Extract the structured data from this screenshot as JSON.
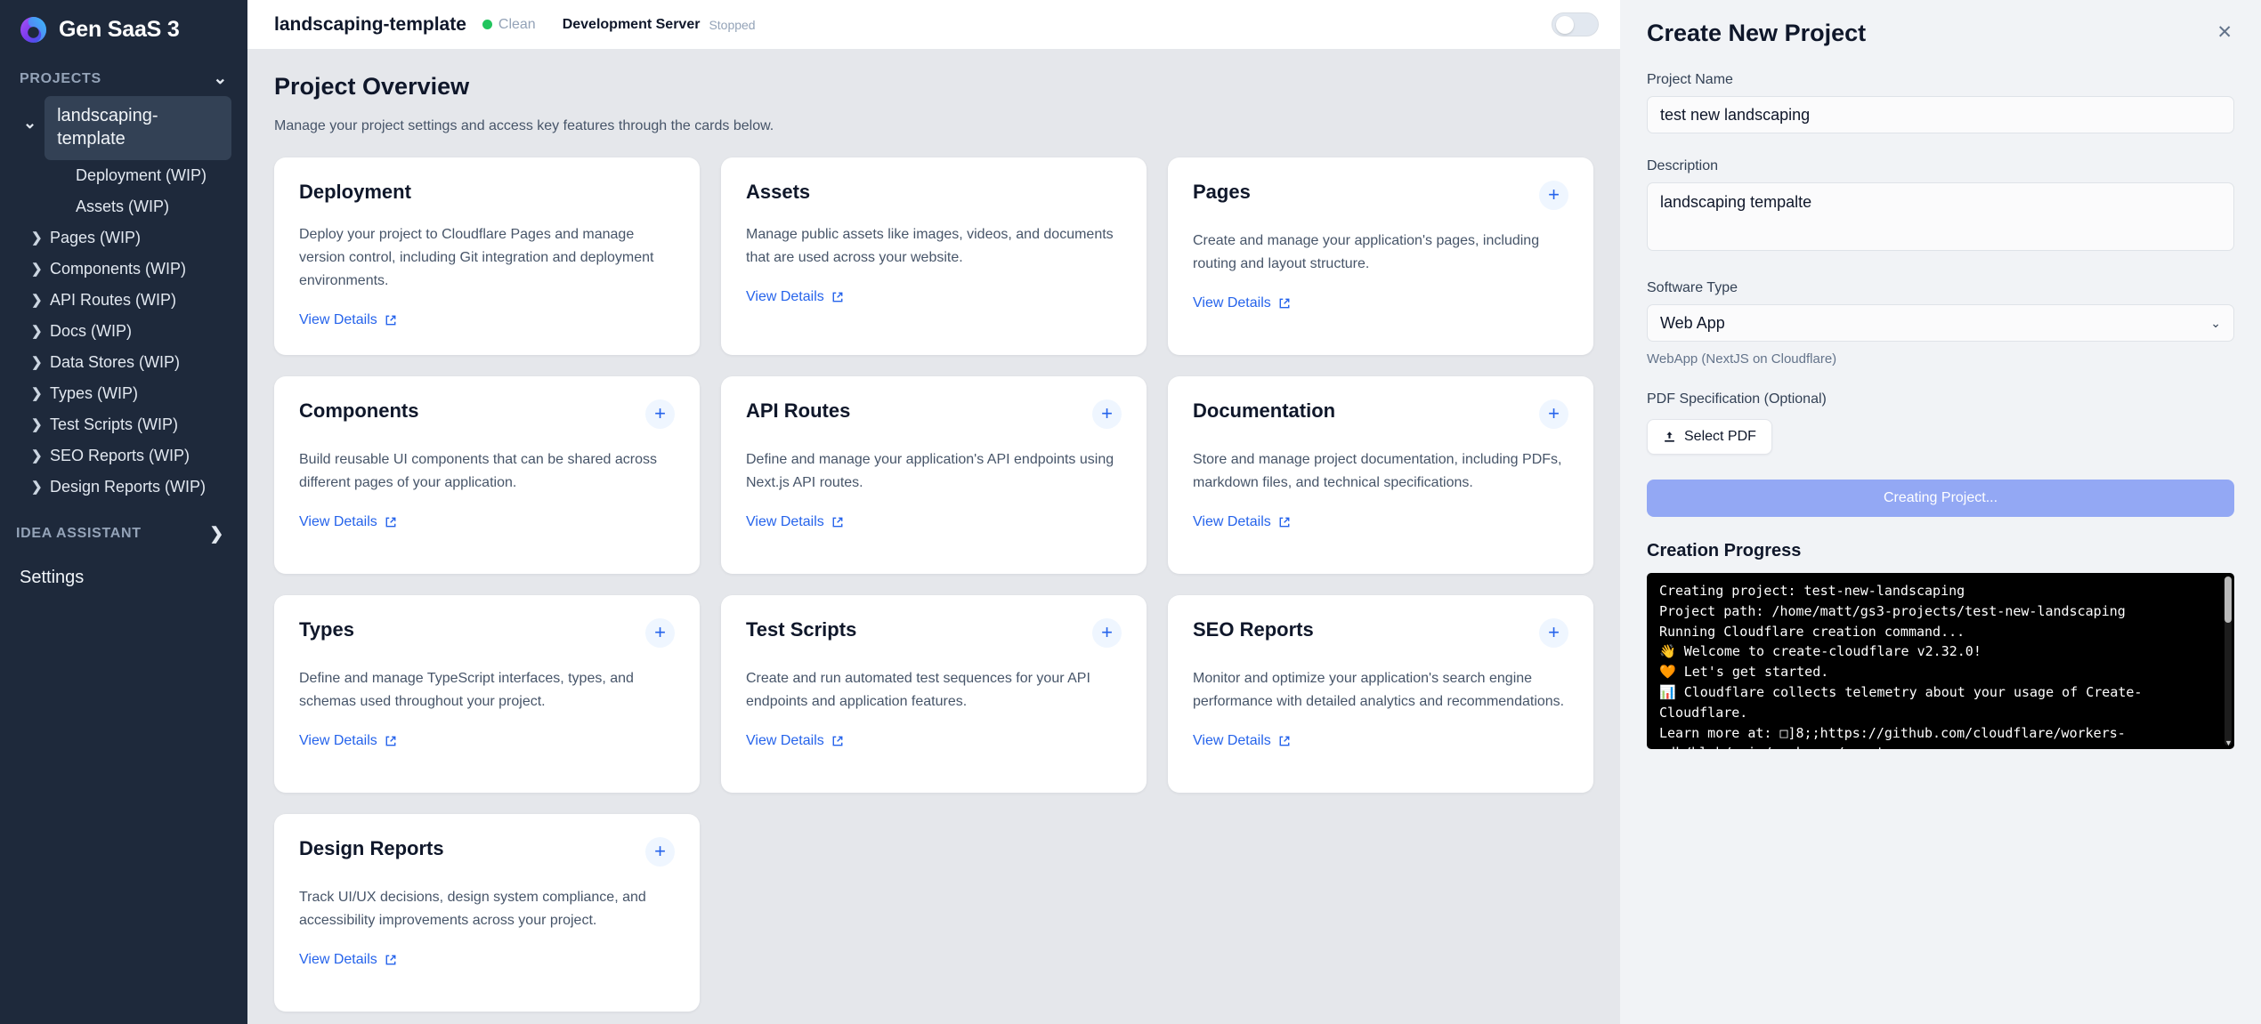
{
  "sidebar": {
    "brand": "Gen SaaS 3",
    "logo_icon": "swirl-logo-icon",
    "projects_label": "PROJECTS",
    "active_project": "landscaping-template",
    "nav_items": [
      {
        "label": "Deployment (WIP)",
        "has_arrow": false
      },
      {
        "label": "Assets (WIP)",
        "has_arrow": false
      },
      {
        "label": "Pages (WIP)",
        "has_arrow": true
      },
      {
        "label": "Components (WIP)",
        "has_arrow": true
      },
      {
        "label": "API Routes (WIP)",
        "has_arrow": true
      },
      {
        "label": "Docs (WIP)",
        "has_arrow": true
      },
      {
        "label": "Data Stores (WIP)",
        "has_arrow": true
      },
      {
        "label": "Types (WIP)",
        "has_arrow": true
      },
      {
        "label": "Test Scripts (WIP)",
        "has_arrow": true
      },
      {
        "label": "SEO Reports (WIP)",
        "has_arrow": true
      },
      {
        "label": "Design Reports (WIP)",
        "has_arrow": true
      }
    ],
    "idea_assistant_label": "IDEA ASSISTANT",
    "settings_label": "Settings"
  },
  "topbar": {
    "project_title": "landscaping-template",
    "git_status": "Clean",
    "git_status_color": "#22c55e",
    "dev_server_label": "Development Server",
    "dev_server_state": "Stopped",
    "toggle_on": false
  },
  "overview": {
    "title": "Project Overview",
    "subtitle": "Manage your project settings and access key features through the cards below.",
    "view_details_label": "View Details",
    "cards": [
      {
        "title": "Deployment",
        "desc": "Deploy your project to Cloudflare Pages and manage version control, including Git integration and deployment environments.",
        "has_plus": false
      },
      {
        "title": "Assets",
        "desc": "Manage public assets like images, videos, and documents that are used across your website.",
        "has_plus": false
      },
      {
        "title": "Pages",
        "desc": "Create and manage your application's pages, including routing and layout structure.",
        "has_plus": true
      },
      {
        "title": "Components",
        "desc": "Build reusable UI components that can be shared across different pages of your application.",
        "has_plus": true
      },
      {
        "title": "API Routes",
        "desc": "Define and manage your application's API endpoints using Next.js API routes.",
        "has_plus": true
      },
      {
        "title": "Documentation",
        "desc": "Store and manage project documentation, including PDFs, markdown files, and technical specifications.",
        "has_plus": true
      },
      {
        "title": "Types",
        "desc": "Define and manage TypeScript interfaces, types, and schemas used throughout your project.",
        "has_plus": true
      },
      {
        "title": "Test Scripts",
        "desc": "Create and run automated test sequences for your API endpoints and application features.",
        "has_plus": true
      },
      {
        "title": "SEO Reports",
        "desc": "Monitor and optimize your application's search engine performance with detailed analytics and recommendations.",
        "has_plus": true
      },
      {
        "title": "Design Reports",
        "desc": "Track UI/UX decisions, design system compliance, and accessibility improvements across your project.",
        "has_plus": true
      }
    ]
  },
  "panel": {
    "title": "Create New Project",
    "close_icon": "close-icon",
    "project_name_label": "Project Name",
    "project_name_value": "test new landscaping",
    "description_label": "Description",
    "description_value": "landscaping tempalte",
    "software_type_label": "Software Type",
    "software_type_value": "Web App",
    "software_type_hint": "WebApp (NextJS on Cloudflare)",
    "pdf_label": "PDF Specification (Optional)",
    "select_pdf_label": "Select PDF",
    "submit_label": "Creating Project...",
    "submit_color": "#93a8f4",
    "progress_label": "Creation Progress",
    "terminal_text": "Creating project: test-new-landscaping\nProject path: /home/matt/gs3-projects/test-new-landscaping\nRunning Cloudflare creation command...\n👋 Welcome to create-cloudflare v2.32.0!\n🧡 Let's get started.\n📊 Cloudflare collects telemetry about your usage of Create-Cloudflare.\nLearn more at: □]8;;https://github.com/cloudflare/workers-sdk/blob/main/packages/create-"
  }
}
